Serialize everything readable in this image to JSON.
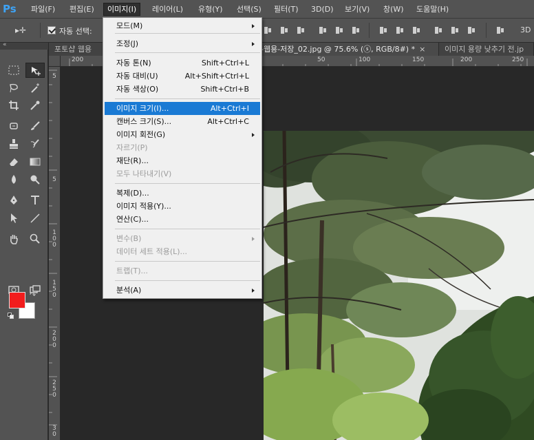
{
  "app": {
    "logo": "Ps"
  },
  "menubar": {
    "items": [
      {
        "label": "파일(F)"
      },
      {
        "label": "편집(E)"
      },
      {
        "label": "이미지(I)"
      },
      {
        "label": "레이어(L)"
      },
      {
        "label": "유형(Y)"
      },
      {
        "label": "선택(S)"
      },
      {
        "label": "필터(T)"
      },
      {
        "label": "3D(D)"
      },
      {
        "label": "보기(V)"
      },
      {
        "label": "창(W)"
      },
      {
        "label": "도움말(H)"
      }
    ]
  },
  "options_bar": {
    "auto_select_label": "자동 선택:",
    "auto_select_checked": true,
    "mode_3d_label": "3D"
  },
  "tabs": [
    {
      "label": "포토샵 웹용"
    },
    {
      "label": "-웹용-저장_02.jpg @ 75.6% (ⓢ, RGB/8#) *",
      "close": "×"
    },
    {
      "label": "이미지 용량 낮추기 전.jp"
    }
  ],
  "ruler_top": [
    "200",
    "1",
    "50",
    "100",
    "150",
    "200",
    "250"
  ],
  "ruler_left": [
    "5",
    "5",
    "1 0 0",
    "1 5 0",
    "2 0 0",
    "2 5 0",
    "3 0"
  ],
  "colors": {
    "foreground": "#f21d1d",
    "background": "#ffffff",
    "menu_highlight": "#1a7ad4"
  },
  "image_menu": {
    "items": [
      {
        "label": "모드(M)",
        "shortcut": "",
        "submenu": true,
        "disabled": false
      },
      {
        "label": "조정(J)",
        "shortcut": "",
        "submenu": true,
        "disabled": false
      },
      {
        "label": "자동 톤(N)",
        "shortcut": "Shift+Ctrl+L",
        "submenu": false,
        "disabled": false
      },
      {
        "label": "자동 대비(U)",
        "shortcut": "Alt+Shift+Ctrl+L",
        "submenu": false,
        "disabled": false
      },
      {
        "label": "자동 색상(O)",
        "shortcut": "Shift+Ctrl+B",
        "submenu": false,
        "disabled": false
      },
      {
        "label": "이미지 크기(I)...",
        "shortcut": "Alt+Ctrl+I",
        "submenu": false,
        "disabled": false,
        "highlighted": true
      },
      {
        "label": "캔버스 크기(S)...",
        "shortcut": "Alt+Ctrl+C",
        "submenu": false,
        "disabled": false
      },
      {
        "label": "이미지 회전(G)",
        "shortcut": "",
        "submenu": true,
        "disabled": false
      },
      {
        "label": "자르기(P)",
        "shortcut": "",
        "submenu": false,
        "disabled": true
      },
      {
        "label": "재단(R)...",
        "shortcut": "",
        "submenu": false,
        "disabled": false
      },
      {
        "label": "모두 나타내기(V)",
        "shortcut": "",
        "submenu": false,
        "disabled": true
      },
      {
        "label": "복제(D)...",
        "shortcut": "",
        "submenu": false,
        "disabled": false
      },
      {
        "label": "이미지 적용(Y)...",
        "shortcut": "",
        "submenu": false,
        "disabled": false
      },
      {
        "label": "연산(C)...",
        "shortcut": "",
        "submenu": false,
        "disabled": false
      },
      {
        "label": "변수(B)",
        "shortcut": "",
        "submenu": true,
        "disabled": true
      },
      {
        "label": "데이터 세트 적용(L)...",
        "shortcut": "",
        "submenu": false,
        "disabled": true
      },
      {
        "label": "트랩(T)...",
        "shortcut": "",
        "submenu": false,
        "disabled": true
      },
      {
        "label": "분석(A)",
        "shortcut": "",
        "submenu": true,
        "disabled": false
      }
    ]
  }
}
